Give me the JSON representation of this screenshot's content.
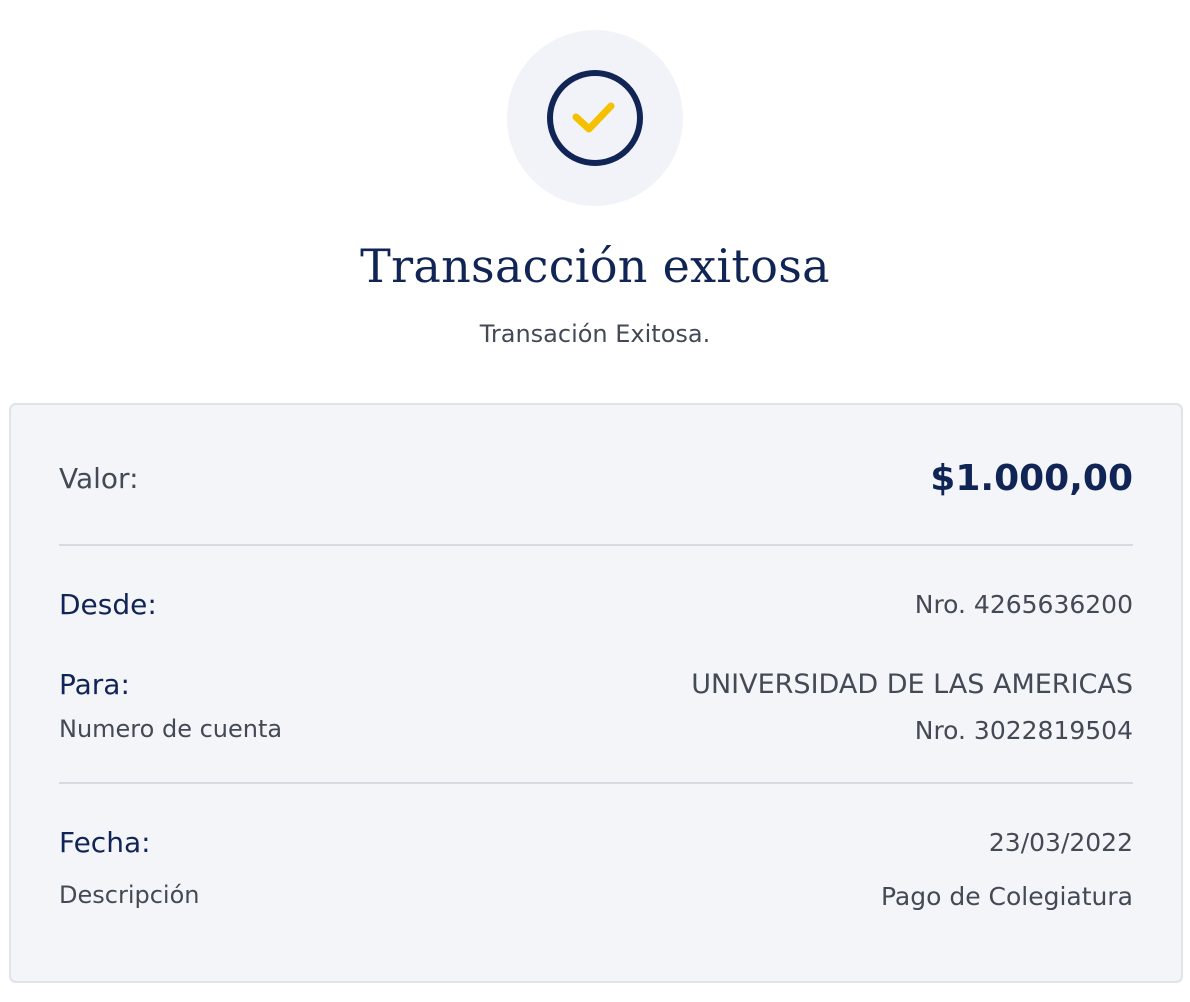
{
  "header": {
    "status_icon": "check-circle-icon",
    "title": "Transacción exitosa",
    "subtitle": "Transación Exitosa."
  },
  "colors": {
    "brand_navy": "#102555",
    "check_yellow": "#f5c000",
    "card_background": "#f3f5f9",
    "text_grey": "#444a55"
  },
  "details": {
    "amount": {
      "label": "Valor:",
      "value": "$1.000,00"
    },
    "from": {
      "label": "Desde:",
      "value": "Nro. 4265636200"
    },
    "to": {
      "label": "Para:",
      "value": "UNIVERSIDAD DE LAS AMERICAS",
      "account_label": "Numero de cuenta",
      "account_value": "Nro. 3022819504"
    },
    "date": {
      "label": "Fecha:",
      "value": "23/03/2022"
    },
    "description": {
      "label": "Descripción",
      "value": "Pago de Colegiatura"
    }
  }
}
